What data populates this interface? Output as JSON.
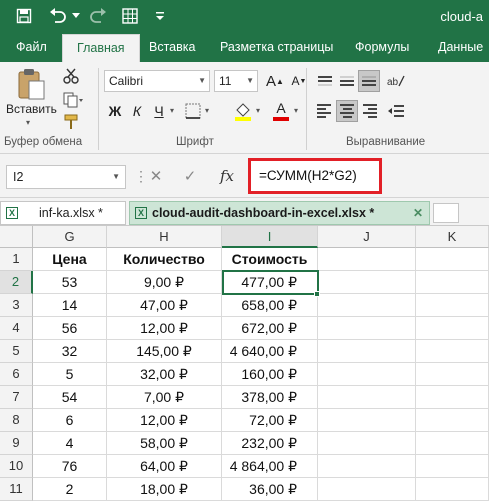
{
  "window": {
    "title": "cloud-a"
  },
  "ribbon_tabs": [
    "Файл",
    "Главная",
    "Вставка",
    "Разметка страницы",
    "Формулы",
    "Данные"
  ],
  "ribbon": {
    "paste_label": "Вставить",
    "font_name": "Calibri",
    "font_size": "11",
    "bold": "Ж",
    "italic": "К",
    "underline": "Ч",
    "grow_font": "A",
    "shrink_font": "A",
    "font_color_glyph": "A",
    "groups": {
      "clipboard": "Буфер обмена",
      "font": "Шрифт",
      "alignment": "Выравнивание"
    }
  },
  "formula_bar": {
    "name_box": "I2",
    "cancel": "✕",
    "enter": "✓",
    "fx": "fx",
    "formula": "=СУММ(H2*G2)"
  },
  "workbook_tabs": [
    {
      "label": "inf-ka.xlsx *",
      "close": ""
    },
    {
      "label": "cloud-audit-dashboard-in-excel.xlsx *",
      "close": "✕"
    }
  ],
  "grid": {
    "columns": [
      "G",
      "H",
      "I",
      "J",
      "K"
    ],
    "selected_column": "I",
    "selected_row": "2",
    "row_numbers": [
      "1",
      "2",
      "3",
      "4",
      "5",
      "6",
      "7",
      "8",
      "9",
      "10",
      "11"
    ],
    "header": [
      "Цена",
      "Количество",
      "Стоимость"
    ],
    "rows": [
      [
        "53",
        "9,00 ₽",
        "477,00 ₽"
      ],
      [
        "14",
        "47,00 ₽",
        "658,00 ₽"
      ],
      [
        "56",
        "12,00 ₽",
        "672,00 ₽"
      ],
      [
        "32",
        "145,00 ₽",
        "4 640,00 ₽"
      ],
      [
        "5",
        "32,00 ₽",
        "160,00 ₽"
      ],
      [
        "54",
        "7,00 ₽",
        "378,00 ₽"
      ],
      [
        "6",
        "12,00 ₽",
        "72,00 ₽"
      ],
      [
        "4",
        "58,00 ₽",
        "232,00 ₽"
      ],
      [
        "76",
        "64,00 ₽",
        "4 864,00 ₽"
      ],
      [
        "2",
        "18,00 ₽",
        "36,00 ₽"
      ]
    ]
  },
  "colors": {
    "accent": "#217346",
    "highlight_border": "#e21f26"
  }
}
